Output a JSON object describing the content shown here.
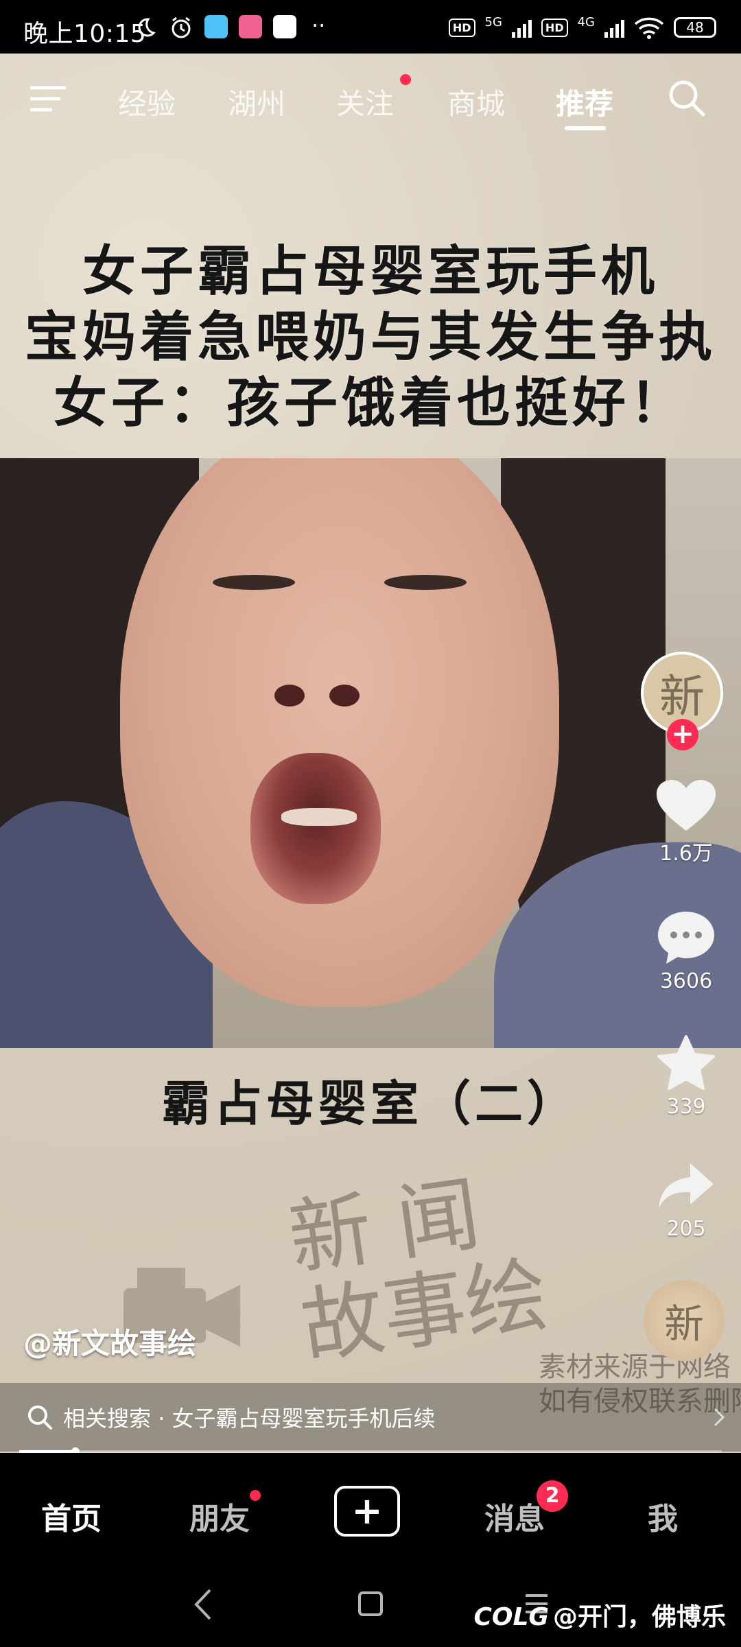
{
  "status_bar": {
    "time": "晚上10:15",
    "network_left": "5G",
    "network_right": "4G",
    "hd_label": "HD",
    "battery": "48",
    "more": "··"
  },
  "top_nav": {
    "tabs": [
      {
        "label": "经验"
      },
      {
        "label": "湖州"
      },
      {
        "label": "关注"
      },
      {
        "label": "商城"
      },
      {
        "label": "推荐"
      }
    ]
  },
  "video": {
    "headline_line1": "女子霸占母婴室玩手机",
    "headline_line2": "宝妈着急喂奶与其发生争执",
    "headline_line3": "女子：孩子饿着也挺好！",
    "subtitle": "霸占母婴室（二）",
    "watermark_line1": "新 闻",
    "watermark_line2": "故事绘",
    "disclaimer_line1": "素材来源于网络",
    "disclaimer_line2": "如有侵权联系删除"
  },
  "side_actions": {
    "avatar_glyph": "新",
    "like_count": "1.6万",
    "comment_count": "3606",
    "favorite_count": "339",
    "share_count": "205",
    "disc_glyph": "新"
  },
  "author": "@新文故事绘",
  "related_search": {
    "text": "相关搜索 · 女子霸占母婴室玩手机后续"
  },
  "progress": {
    "fraction": 0.08
  },
  "bottom_nav": {
    "home": "首页",
    "friends": "朋友",
    "messages": "消息",
    "messages_badge": "2",
    "me": "我"
  },
  "watermark": "@开门，佛博乐",
  "watermark_logo": "COLG",
  "colors": {
    "accent": "#fe2c55",
    "background": "#000000"
  }
}
